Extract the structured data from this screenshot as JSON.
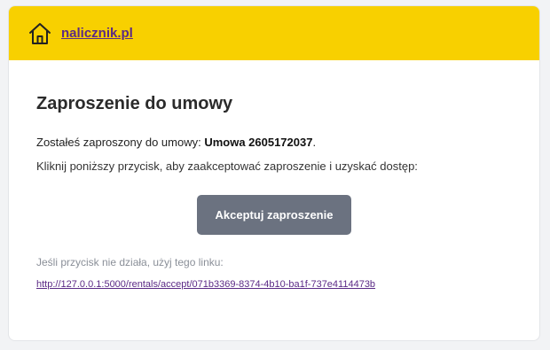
{
  "header": {
    "brand_label": "nalicznik.pl",
    "brand_icon": "house-icon",
    "background_color": "#f8d000",
    "link_color": "#5b2a86"
  },
  "main": {
    "title": "Zaproszenie do umowy",
    "invite_prefix": "Zostałeś zaproszony do umowy: ",
    "contract_name": "Umowa 2605172037",
    "invite_suffix": ".",
    "instruction": "Kliknij poniższy przycisk, aby zaakceptować zaproszenie i uzyskać dostęp:",
    "accept_button_label": "Akceptuj zaproszenie",
    "accept_button_color": "#6b7280",
    "fallback_text": "Jeśli przycisk nie działa, użyj tego linku:",
    "fallback_url": "http://127.0.0.1:5000/rentals/accept/071b3369-8374-4b10-ba1f-737e4114473b"
  }
}
